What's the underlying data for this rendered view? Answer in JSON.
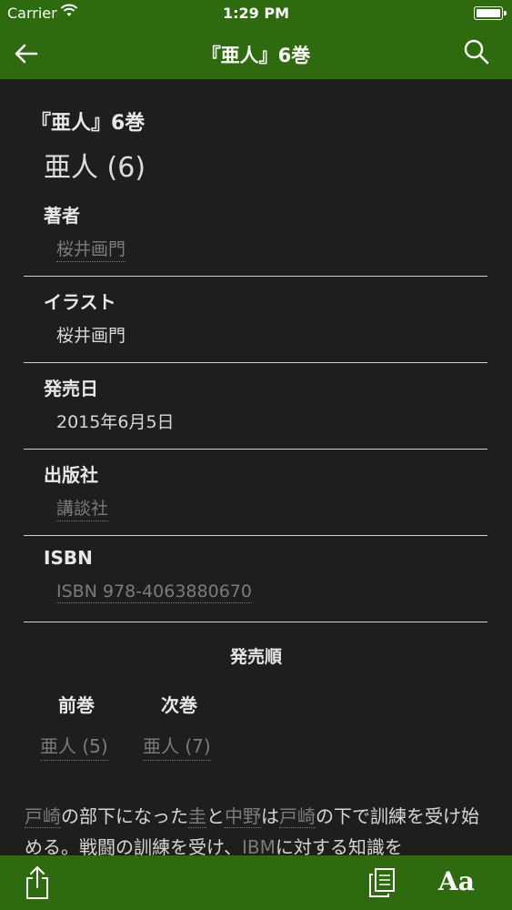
{
  "status_bar": {
    "carrier": "Carrier",
    "time": "1:29 PM"
  },
  "nav": {
    "title": "『亜人』6巻"
  },
  "header": {
    "title": "『亜人』6巻",
    "subtitle": "亜人 (6)"
  },
  "fields": {
    "author": {
      "label": "著者",
      "value": "桜井画門"
    },
    "illustration": {
      "label": "イラスト",
      "value": "桜井画門"
    },
    "release_date": {
      "label": "発売日",
      "value": "2015年6月5日"
    },
    "publisher": {
      "label": "出版社",
      "value": "講談社"
    },
    "isbn": {
      "label": "ISBN",
      "value": "ISBN 978-4063880670"
    }
  },
  "release_order": {
    "title": "発売順",
    "prev_label": "前巻",
    "next_label": "次巻",
    "prev_value": "亜人 (5)",
    "next_value": "亜人 (7)"
  },
  "description": {
    "s1": "戸崎",
    "s2": "の部下になった",
    "s3": "圭",
    "s4": "と",
    "s5": "中野",
    "s6": "は",
    "s7": "戸崎",
    "s8": "の下で訓練を受け始める。戦闘の訓練を受け、",
    "s9": "IBM",
    "s10": "に対する知識を"
  },
  "toolbar": {
    "font_label": "Aa"
  },
  "icons": [
    "wifi-icon",
    "battery-icon",
    "back-arrow-icon",
    "search-icon",
    "share-icon",
    "copy-icon",
    "font-size-icon"
  ],
  "colors": {
    "bar_green": "#2e6b0f",
    "background": "#1f1e1f",
    "link_gray": "#7b7b7b"
  }
}
